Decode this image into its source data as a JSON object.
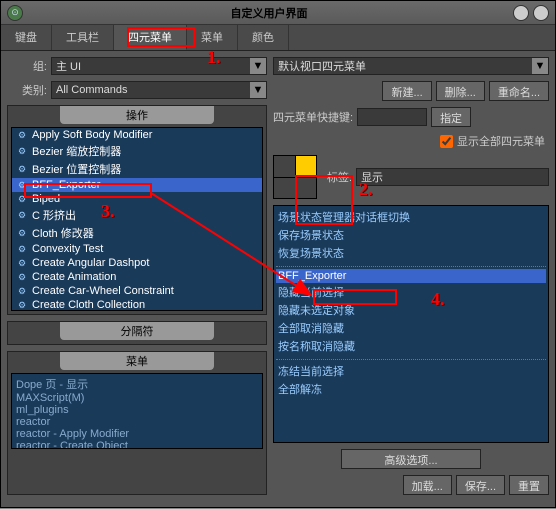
{
  "title": "自定义用户界面",
  "tabs": [
    "键盘",
    "工具栏",
    "四元菜单",
    "菜单",
    "颜色"
  ],
  "active_tab": 2,
  "left": {
    "group_label": "组:",
    "group_value": "主 UI",
    "category_label": "类别:",
    "category_value": "All Commands",
    "actions_header": "操作",
    "actions": [
      "Apply Soft Body Modifier",
      "Bezier 缩放控制器",
      "Bezier 位置控制器",
      "BFF_Exporter",
      "Biped",
      "C 形挤出",
      "Cloth 修改器",
      "Convexity Test",
      "Create Angular Dashpot",
      "Create Animation",
      "Create Car-Wheel Constraint",
      "Create Cloth Collection"
    ],
    "actions_selected": 3,
    "separator_header": "分隔符",
    "menu_header": "菜单",
    "menus": [
      "Dope 页 - 显示",
      "MAXScript(M)",
      "ml_plugins",
      "reactor",
      "reactor - Apply Modifier",
      "reactor - Create Object"
    ]
  },
  "right": {
    "quad_select_value": "默认视口四元菜单",
    "buttons_top": {
      "new": "新建...",
      "delete": "删除...",
      "rename": "重命名..."
    },
    "shortcut_label": "四元菜单快捷键:",
    "shortcut_value": "",
    "assign": "指定",
    "show_all": "显示全部四元菜单",
    "show_all_checked": true,
    "label_label": "标签:",
    "label_value": "显示",
    "context_items": [
      "场景状态管理器对话框切换",
      "保存场景状态",
      "恢复场景状态",
      "",
      "BFF_Exporter",
      "隐藏当前选择",
      "隐藏未选定对象",
      "全部取消隐藏",
      "按名称取消隐藏",
      "",
      "冻结当前选择",
      "全部解冻"
    ],
    "context_selected": 4,
    "advanced": "高级选项...",
    "buttons_bottom": {
      "load": "加载...",
      "save": "保存...",
      "reset": "重置"
    }
  },
  "annotations": {
    "n1": "1.",
    "n2": "2.",
    "n3": "3.",
    "n4": "4."
  }
}
